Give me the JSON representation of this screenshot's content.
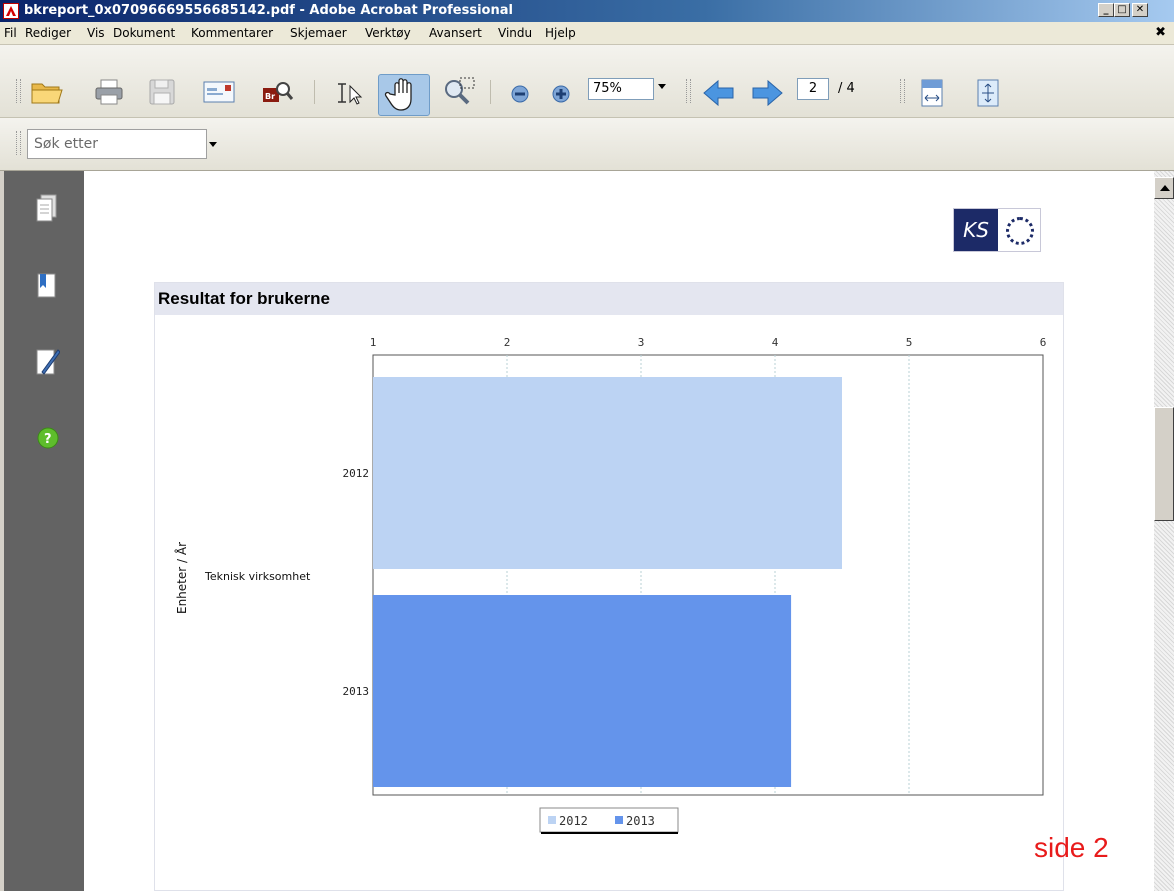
{
  "window": {
    "title": "bkreport_0x07096669556685142.pdf - Adobe Acrobat Professional",
    "min_label": "_",
    "max_label": "□",
    "close_label": "✕"
  },
  "menu": [
    "Fil",
    "Rediger",
    "Vis",
    "Dokument",
    "Kommentarer",
    "Skjemaer",
    "Verktøy",
    "Avansert",
    "Vindu",
    "Hjelp"
  ],
  "menu_close": "✖",
  "toolbar": {
    "zoom": "75%",
    "page_current": "2",
    "page_total": "/ 4"
  },
  "search": {
    "placeholder": "Søk etter"
  },
  "report": {
    "title": "Resultat for brukerne",
    "page_label": "side 2"
  },
  "chart_data": {
    "type": "bar",
    "orientation": "horizontal",
    "title": "",
    "group": "Teknisk virksomhet",
    "ylabel": "Enheter / År",
    "xlabel": "",
    "xlim": [
      1,
      6
    ],
    "xticks": [
      "1",
      "2",
      "3",
      "4",
      "5",
      "6"
    ],
    "categories": [
      "2012",
      "2013"
    ],
    "series": [
      {
        "name": "2012",
        "values": [
          4.5
        ],
        "color": "#bcd3f3"
      },
      {
        "name": "2013",
        "values": [
          4.12
        ],
        "color": "#6494eb"
      }
    ],
    "grid": true,
    "legend": "bottom"
  }
}
